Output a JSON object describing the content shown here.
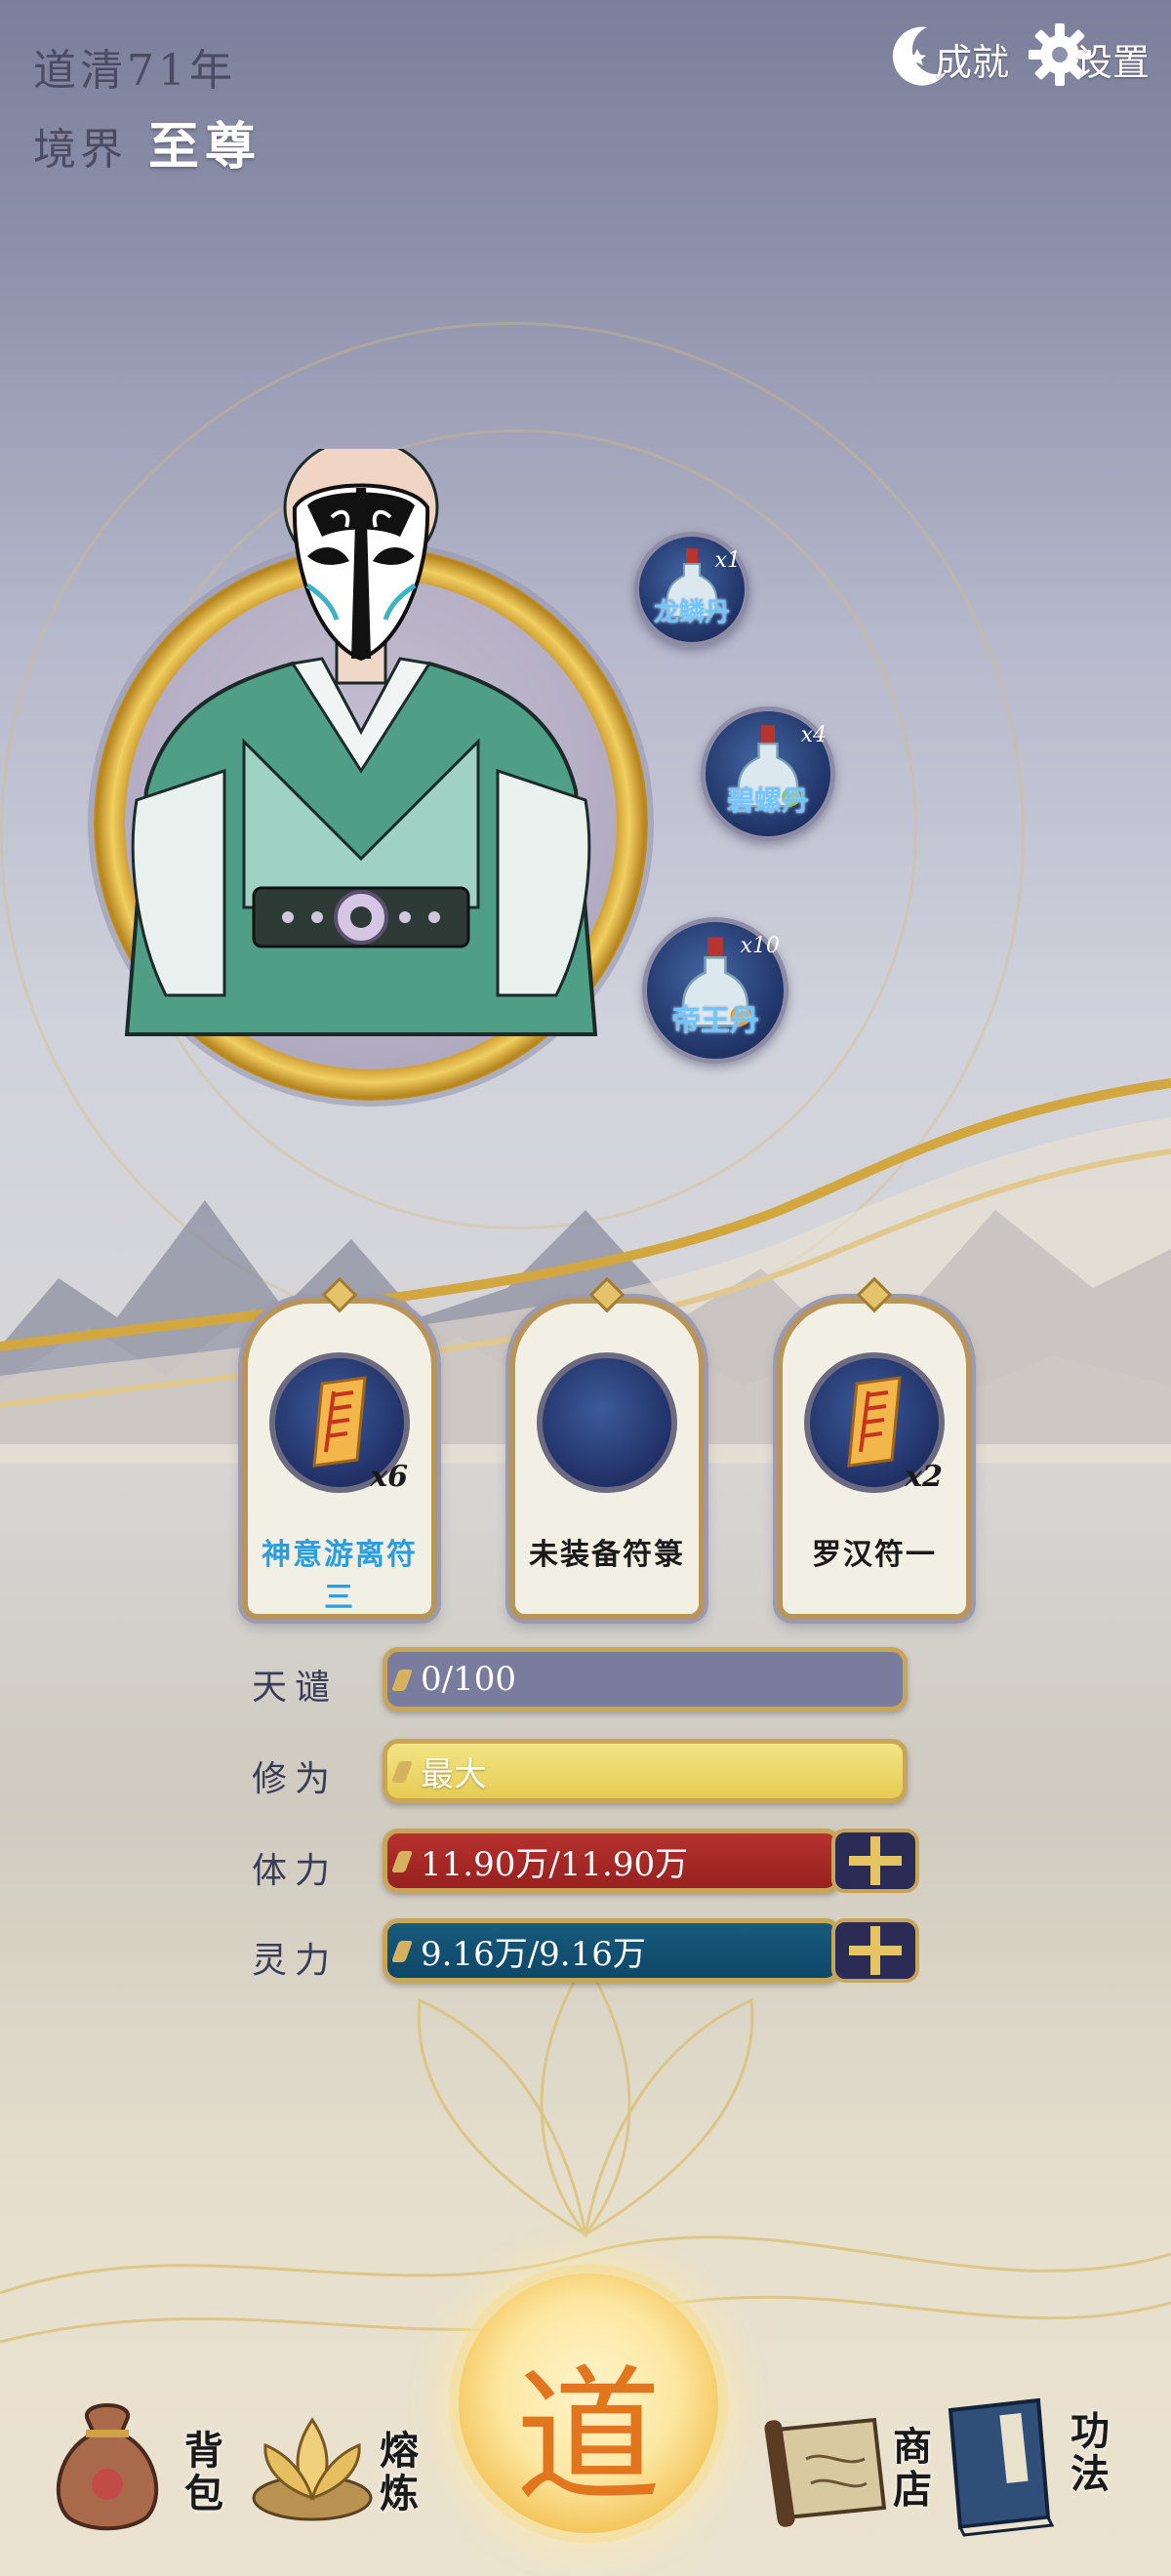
{
  "header": {
    "era": "道清71年",
    "realm_label": "境界",
    "realm_value": "至尊"
  },
  "top_buttons": {
    "achievements": "成就",
    "settings": "设置"
  },
  "pills": [
    {
      "name": "龙鳞丹",
      "count": "x1"
    },
    {
      "name": "碧螺丹",
      "count": "x4"
    },
    {
      "name": "帝王丹",
      "count": "x10"
    }
  ],
  "talismans": [
    {
      "name": "神意游离符三",
      "count": "x6",
      "equipped": true
    },
    {
      "name": "未装备符箓",
      "count": "",
      "equipped": false
    },
    {
      "name": "罗汉符一",
      "count": "x2",
      "equipped": true
    }
  ],
  "stats": {
    "tianqian": {
      "label": "天谴",
      "value": "0/100"
    },
    "xiuwei": {
      "label": "修为",
      "value": "最大"
    },
    "tili": {
      "label": "体力",
      "value": "11.90万/11.90万"
    },
    "lingli": {
      "label": "灵力",
      "value": "9.16万/9.16万"
    }
  },
  "center_button": {
    "label": "道"
  },
  "nav": {
    "bag": "背包",
    "refine": "熔炼",
    "shop": "商店",
    "skills": "功法"
  },
  "colors": {
    "gold": "#c9a55a",
    "stamina_red": "#b5312e",
    "spirit_teal": "#175a7d",
    "cultivation_yellow": "#f3e584",
    "sky": "#7c7f9b"
  }
}
